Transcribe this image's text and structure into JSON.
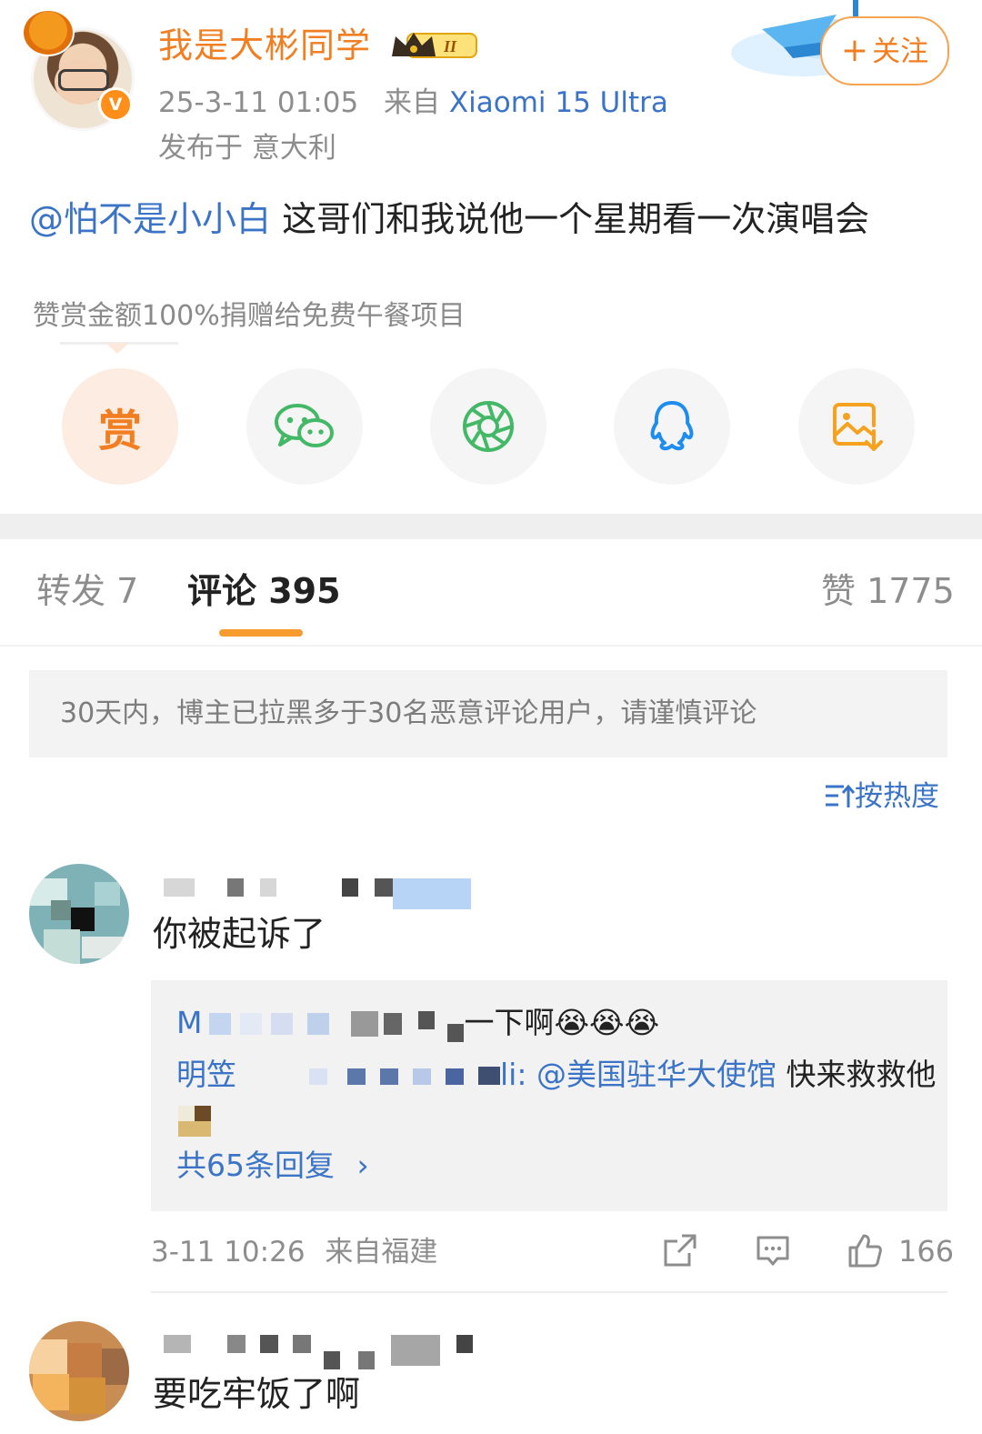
{
  "post": {
    "author": "我是大彬同学",
    "vip_label": "II",
    "time": "25-3-11 01:05",
    "source_prefix": "来自",
    "device": "Xiaomi 15 Ultra",
    "location": "发布于 意大利",
    "follow_label": "关注",
    "follow_plus": "+",
    "mention": "@怕不是小小白",
    "text": " 这哥们和我说他一个星期看一次演唱会"
  },
  "reward": {
    "note": "赞赏金额100%捐赠给免费午餐项目",
    "reward_glyph": "赏",
    "share_icons": [
      "reward-icon",
      "wechat-icon",
      "moments-icon",
      "qq-icon",
      "save-image-icon"
    ]
  },
  "tabs": {
    "repost": "转发 7",
    "comment": "评论 395",
    "like": "赞 1775"
  },
  "notice": "30天内，博主已拉黑多于30名恶意评论用户，请谨慎评论",
  "sort_label": "按热度",
  "sort_icon": "sort-icon",
  "comments": [
    {
      "text": "你被起诉了",
      "replies": [
        {
          "prefix": "M",
          "suffix": "一下啊",
          "emoji": "😭😭😭"
        },
        {
          "prefix": "明笠",
          "suffix": "li: ",
          "mention": "@美国驻华大使馆",
          "text": " 快来救救他"
        }
      ],
      "more_replies": "共65条回复",
      "more_chevron": "›",
      "time": "3-11 10:26",
      "source": "来自福建",
      "likes": "166"
    },
    {
      "text": "要吃牢饭了啊"
    }
  ],
  "colors": {
    "accent_orange": "#f27e22",
    "link_blue": "#3b74c7"
  }
}
